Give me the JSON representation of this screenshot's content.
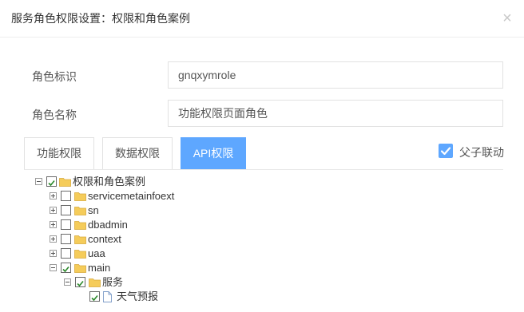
{
  "dialog": {
    "title": "服务角色权限设置：权限和角色案例",
    "close_glyph": "×"
  },
  "form": {
    "role_id": {
      "label": "角色标识",
      "value": "gnqxymrole"
    },
    "role_name": {
      "label": "角色名称",
      "value": "功能权限页面角色"
    }
  },
  "tabs": [
    {
      "label": "功能权限",
      "active": false
    },
    {
      "label": "数据权限",
      "active": false
    },
    {
      "label": "API权限",
      "active": true
    }
  ],
  "linkage": {
    "label": "父子联动",
    "checked": true
  },
  "colors": {
    "accent": "#5ea7ff",
    "check_green": "#2d8a2d",
    "folder": "#f5cc5a"
  },
  "tree": {
    "root": {
      "label": "权限和角色案例",
      "checked": true,
      "expanded": true
    },
    "children": [
      {
        "label": "servicemetainfoext",
        "checked": false,
        "expanded": false
      },
      {
        "label": "sn",
        "checked": false,
        "expanded": false
      },
      {
        "label": "dbadmin",
        "checked": false,
        "expanded": false
      },
      {
        "label": "context",
        "checked": false,
        "expanded": false
      },
      {
        "label": "uaa",
        "checked": false,
        "expanded": false
      },
      {
        "label": "main",
        "checked": true,
        "expanded": true
      }
    ],
    "main_child": {
      "label": "服务",
      "checked": true,
      "expanded": true,
      "icon": "folder-icon"
    },
    "leaf": {
      "label": "天气预报",
      "checked": true,
      "icon": "file-icon"
    }
  }
}
